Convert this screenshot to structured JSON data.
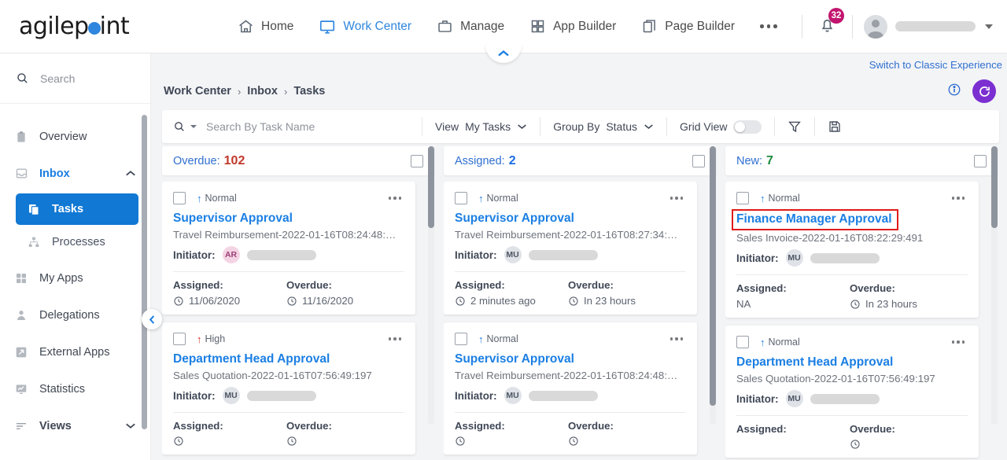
{
  "brand": {
    "name_part1": "agilep",
    "name_part2": "int"
  },
  "topnav": {
    "items": [
      {
        "label": "Home",
        "icon": "home-icon",
        "active": false
      },
      {
        "label": "Work Center",
        "icon": "monitor-icon",
        "active": true
      },
      {
        "label": "Manage",
        "icon": "briefcase-icon",
        "active": false
      },
      {
        "label": "App Builder",
        "icon": "grid-icon",
        "active": false
      },
      {
        "label": "Page Builder",
        "icon": "pages-icon",
        "active": false
      }
    ],
    "more_label": "•••",
    "notification_count": "32",
    "user_name": ""
  },
  "sidebar": {
    "search_placeholder": "Search",
    "items": [
      {
        "label": "Overview",
        "icon": "clipboard-icon"
      },
      {
        "label": "Inbox",
        "icon": "inbox-icon"
      },
      {
        "label": "Tasks",
        "icon": "tasks-icon"
      },
      {
        "label": "Processes",
        "icon": "hierarchy-icon"
      },
      {
        "label": "My Apps",
        "icon": "apps-grid-icon"
      },
      {
        "label": "Delegations",
        "icon": "person-icon"
      },
      {
        "label": "External Apps",
        "icon": "external-link-icon"
      },
      {
        "label": "Statistics",
        "icon": "chart-monitor-icon"
      },
      {
        "label": "Views",
        "icon": "list-lines-icon"
      }
    ]
  },
  "main": {
    "switch_link": "Switch to Classic Experience",
    "breadcrumb": [
      "Work Center",
      "Inbox",
      "Tasks"
    ],
    "breadcrumb_separator": "›"
  },
  "toolbar": {
    "search_placeholder": "Search By Task Name",
    "view_label": "View",
    "view_value": "My Tasks",
    "group_by_label": "Group By",
    "group_by_value": "Status",
    "grid_view_label": "Grid View",
    "grid_view_on": false,
    "filter_icon": "funnel-icon",
    "save_icon": "floppy-save-icon"
  },
  "columns": [
    {
      "title": "Overdue:",
      "count": "102",
      "count_color": "#c0392b",
      "cards": [
        {
          "priority": "Normal",
          "priority_class": "normal",
          "title": "Supervisor Approval",
          "subtitle": "Travel Reimbursement-2022-01-16T08:24:48:…",
          "initiator_label": "Initiator:",
          "initials": "AR",
          "initials_class": "ar",
          "assigned_label": "Assigned:",
          "assigned_value": "11/06/2020",
          "assigned_has_clock": true,
          "overdue_label": "Overdue:",
          "overdue_value": "11/16/2020",
          "overdue_has_clock": true,
          "highlighted": false
        },
        {
          "priority": "High",
          "priority_class": "high",
          "title": "Department Head Approval",
          "subtitle": "Sales Quotation-2022-01-16T07:56:49:197",
          "initiator_label": "Initiator:",
          "initials": "MU",
          "initials_class": "mu",
          "assigned_label": "Assigned:",
          "assigned_value": "",
          "assigned_has_clock": true,
          "overdue_label": "Overdue:",
          "overdue_value": "",
          "overdue_has_clock": true,
          "highlighted": false
        }
      ]
    },
    {
      "title": "Assigned:",
      "count": "2",
      "count_color": "#1b6ce0",
      "cards": [
        {
          "priority": "Normal",
          "priority_class": "normal",
          "title": "Supervisor Approval",
          "subtitle": "Travel Reimbursement-2022-01-16T08:27:34:…",
          "initiator_label": "Initiator:",
          "initials": "MU",
          "initials_class": "mu",
          "assigned_label": "Assigned:",
          "assigned_value": "2 minutes ago",
          "assigned_has_clock": true,
          "overdue_label": "Overdue:",
          "overdue_value": "In 23 hours",
          "overdue_has_clock": true,
          "highlighted": false
        },
        {
          "priority": "Normal",
          "priority_class": "normal",
          "title": "Supervisor Approval",
          "subtitle": "Travel Reimbursement-2022-01-16T08:24:48:…",
          "initiator_label": "Initiator:",
          "initials": "MU",
          "initials_class": "mu",
          "assigned_label": "Assigned:",
          "assigned_value": "",
          "assigned_has_clock": true,
          "overdue_label": "Overdue:",
          "overdue_value": "",
          "overdue_has_clock": true,
          "highlighted": false
        }
      ]
    },
    {
      "title": "New:",
      "count": "7",
      "count_color": "#1d8a3c",
      "cards": [
        {
          "priority": "Normal",
          "priority_class": "normal",
          "title": "Finance Manager Approval",
          "subtitle": "Sales Invoice-2022-01-16T08:22:29:491",
          "initiator_label": "Initiator:",
          "initials": "MU",
          "initials_class": "mu",
          "assigned_label": "Assigned:",
          "assigned_value": "NA",
          "assigned_has_clock": false,
          "overdue_label": "Overdue:",
          "overdue_value": "In 23 hours",
          "overdue_has_clock": true,
          "highlighted": true
        },
        {
          "priority": "Normal",
          "priority_class": "normal",
          "title": "Department Head Approval",
          "subtitle": "Sales Quotation-2022-01-16T07:56:49:197",
          "initiator_label": "Initiator:",
          "initials": "MU",
          "initials_class": "mu",
          "assigned_label": "Assigned:",
          "assigned_value": "",
          "assigned_has_clock": false,
          "overdue_label": "Overdue:",
          "overdue_value": "",
          "overdue_has_clock": true,
          "highlighted": false
        }
      ]
    }
  ],
  "colors": {
    "accent_blue": "#1b7fe3",
    "brand_purple": "#7b2fd1",
    "badge_pink": "#c2156e",
    "highlight_red": "#e01b1b"
  }
}
